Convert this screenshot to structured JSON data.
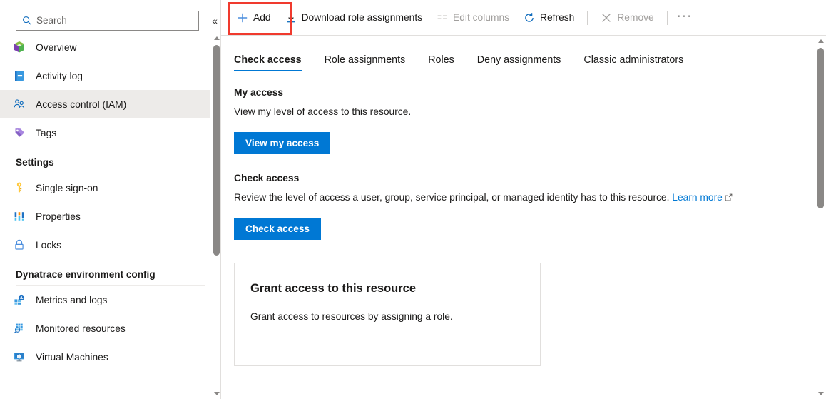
{
  "sidebar": {
    "search": {
      "placeholder": "Search",
      "value": ""
    },
    "collapse_label": "«",
    "items": [
      {
        "label": "Overview",
        "icon": "overview-cube-icon",
        "selected": false
      },
      {
        "label": "Activity log",
        "icon": "activity-log-icon",
        "selected": false
      },
      {
        "label": "Access control (IAM)",
        "icon": "access-control-people-icon",
        "selected": true
      },
      {
        "label": "Tags",
        "icon": "tags-icon",
        "selected": false
      }
    ],
    "groups": [
      {
        "title": "Settings",
        "items": [
          {
            "label": "Single sign-on",
            "icon": "key-icon"
          },
          {
            "label": "Properties",
            "icon": "properties-bars-icon"
          },
          {
            "label": "Locks",
            "icon": "lock-icon"
          }
        ]
      },
      {
        "title": "Dynatrace environment config",
        "items": [
          {
            "label": "Metrics and logs",
            "icon": "metrics-logs-icon"
          },
          {
            "label": "Monitored resources",
            "icon": "monitored-resources-icon"
          },
          {
            "label": "Virtual Machines",
            "icon": "virtual-machines-icon"
          }
        ]
      }
    ]
  },
  "toolbar": {
    "add_label": "Add",
    "download_label": "Download role assignments",
    "edit_columns_label": "Edit columns",
    "refresh_label": "Refresh",
    "remove_label": "Remove",
    "more_label": "···"
  },
  "tabs": [
    {
      "label": "Check access",
      "active": true
    },
    {
      "label": "Role assignments",
      "active": false
    },
    {
      "label": "Roles",
      "active": false
    },
    {
      "label": "Deny assignments",
      "active": false
    },
    {
      "label": "Classic administrators",
      "active": false
    }
  ],
  "main": {
    "my_access": {
      "title": "My access",
      "description": "View my level of access to this resource.",
      "button": "View my access"
    },
    "check_access": {
      "title": "Check access",
      "description": "Review the level of access a user, group, service principal, or managed identity has to this resource.",
      "link": "Learn more",
      "button": "Check access"
    },
    "grant_card": {
      "title": "Grant access to this resource",
      "description": "Grant access to resources by assigning a role."
    }
  },
  "colors": {
    "accent": "#0078d4",
    "highlight": "#f03a2e",
    "selected_row": "#edebe9",
    "border": "#e1dfdd",
    "disabled_text": "#a19f9d"
  }
}
